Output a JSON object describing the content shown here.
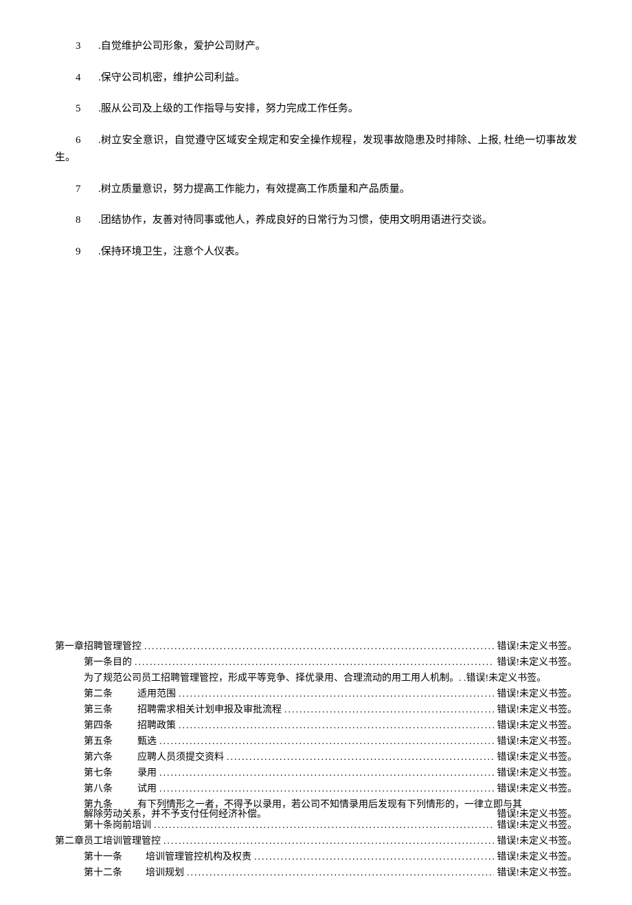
{
  "rules": [
    {
      "num": "3",
      "text": ".自觉维护公司形象，爱护公司财产。"
    },
    {
      "num": "4",
      "text": ".保守公司机密，维护公司利益。"
    },
    {
      "num": "5",
      "text": ".服从公司及上级的工作指导与安排，努力完成工作任务。"
    },
    {
      "num": "6",
      "text": ".树立安全意识，自觉遵守区域安全规定和安全操作规程，发现事故隐患及时排除、上报, 杜绝一切事故发生。"
    },
    {
      "num": "7",
      "text": ".树立质量意识，努力提高工作能力，有效提高工作质量和产品质量。"
    },
    {
      "num": "8",
      "text": ".团结协作，友善对待同事或他人，养成良好的日常行为习惯，使用文明用语进行交谈。"
    },
    {
      "num": "9",
      "text": ".保持环境卫生，注意个人仪表。"
    }
  ],
  "err": "错误!未定义书签。",
  "toc": {
    "ch1": {
      "title": "第一章招聘管理管控",
      "items": [
        {
          "lead": "第一条目的",
          "label": ""
        },
        {
          "lead": "",
          "label": "为了规范公司员工招聘管理管控，形成平等竞争、择优录用、合理流动的用工用人机制。. ."
        },
        {
          "lead": "第二条",
          "label": "适用范围"
        },
        {
          "lead": "第三条",
          "label": "招聘需求相关计划申报及审批流程"
        },
        {
          "lead": "第四条",
          "label": "招聘政策"
        },
        {
          "lead": "第五条",
          "label": "甄选"
        },
        {
          "lead": "第六条",
          "label": "应聘人员须提交资料"
        },
        {
          "lead": "第七条",
          "label": "录用"
        },
        {
          "lead": "第八条",
          "label": "试用"
        }
      ],
      "item9": {
        "lead": "第九条",
        "line1": "有下列情形之一者，不得予以录用，若公司不知情录用后发现有下列情形的，一律立即与其",
        "line2": "解除劳动关系，并不予支付任何经济补偿。"
      },
      "item10": {
        "lead": "第十条岗前培训",
        "label": ""
      }
    },
    "ch2": {
      "title": "第二章员工培训管理管控",
      "items": [
        {
          "lead": "第十一条",
          "label": "培训管理管控机构及权责"
        },
        {
          "lead": "第十二条",
          "label": "培训规划"
        }
      ]
    }
  }
}
